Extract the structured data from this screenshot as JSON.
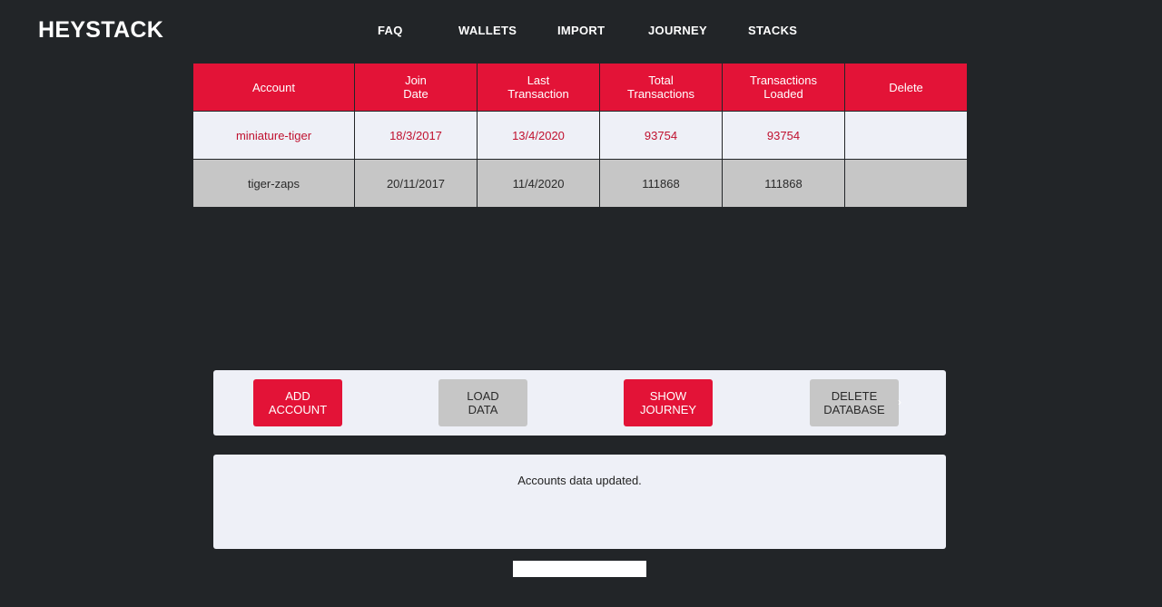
{
  "brand": "HEYSTACK",
  "nav": {
    "faq": "FAQ",
    "wallets": "WALLETS",
    "import": "IMPORT",
    "journey": "JOURNEY",
    "stacks": "STACKS"
  },
  "table": {
    "headers": [
      "Account",
      "Join\nDate",
      "Last\nTransaction",
      "Total\nTransactions",
      "Transactions\nLoaded",
      "Delete"
    ],
    "rows": [
      {
        "account": "miniature-tiger",
        "join_date": "18/3/2017",
        "last_transaction": "13/4/2020",
        "total_transactions": "93754",
        "transactions_loaded": "93754",
        "delete": ""
      },
      {
        "account": "tiger-zaps",
        "join_date": "20/11/2017",
        "last_transaction": "11/4/2020",
        "total_transactions": "111868",
        "transactions_loaded": "111868",
        "delete": ""
      }
    ]
  },
  "buttons": {
    "add_account": "ADD\nACCOUNT",
    "load_data": "LOAD\nDATA",
    "show_journey": "SHOW\nJOURNEY",
    "delete_database": "DELETE\nDATABASE"
  },
  "status": {
    "message": "Accounts data updated."
  },
  "colors": {
    "accent": "#e31337",
    "background": "#222528",
    "panel": "#eef0f7",
    "grey_row": "#c6c6c6"
  }
}
